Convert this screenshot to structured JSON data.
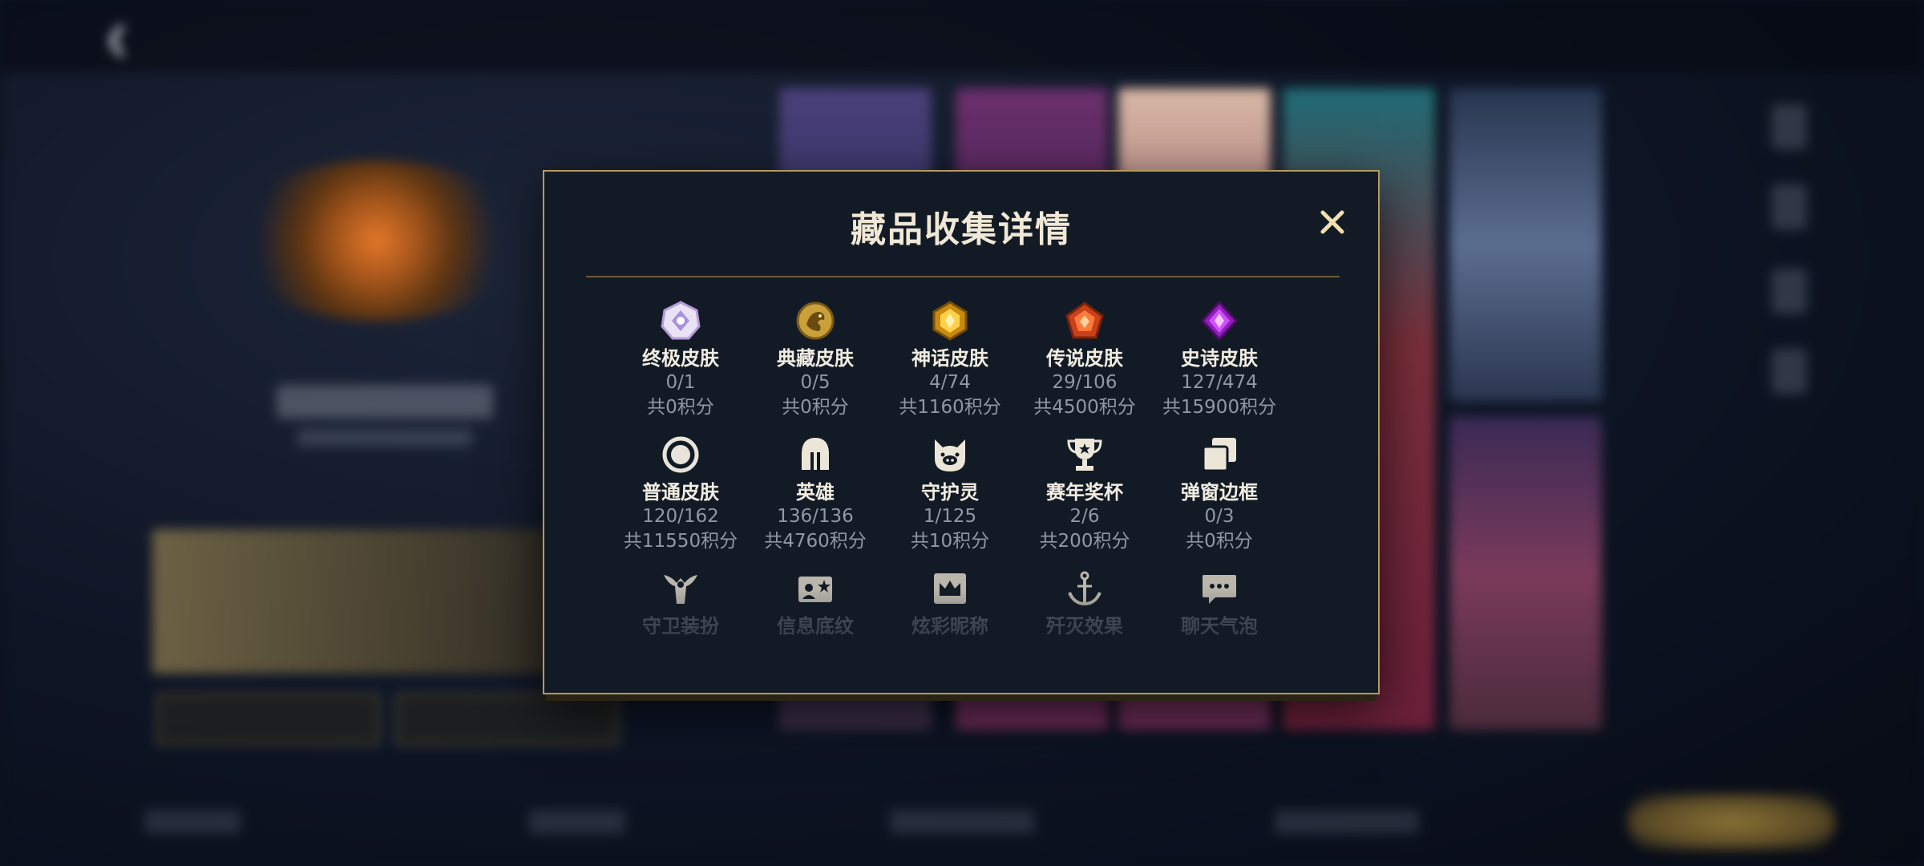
{
  "dialog": {
    "title": "藏品收集详情",
    "close_icon": "close-icon"
  },
  "collections": [
    {
      "name": "终极皮肤",
      "count": "0/1",
      "points": "共0积分",
      "icon": "ultimate-skin-icon"
    },
    {
      "name": "典藏皮肤",
      "count": "0/5",
      "points": "共0积分",
      "icon": "legendary-collection-skin-icon"
    },
    {
      "name": "神话皮肤",
      "count": "4/74",
      "points": "共1160积分",
      "icon": "mythic-skin-icon"
    },
    {
      "name": "传说皮肤",
      "count": "29/106",
      "points": "共4500积分",
      "icon": "legend-skin-icon"
    },
    {
      "name": "史诗皮肤",
      "count": "127/474",
      "points": "共15900积分",
      "icon": "epic-skin-icon"
    },
    {
      "name": "普通皮肤",
      "count": "120/162",
      "points": "共11550积分",
      "icon": "normal-skin-icon"
    },
    {
      "name": "英雄",
      "count": "136/136",
      "points": "共4760积分",
      "icon": "hero-helmet-icon"
    },
    {
      "name": "守护灵",
      "count": "1/125",
      "points": "共10积分",
      "icon": "guardian-spirit-icon"
    },
    {
      "name": "赛年奖杯",
      "count": "2/6",
      "points": "共200积分",
      "icon": "trophy-icon"
    },
    {
      "name": "弹窗边框",
      "count": "0/3",
      "points": "共0积分",
      "icon": "popup-frame-icon"
    },
    {
      "name": "守卫装扮",
      "icon": "guard-outfit-icon"
    },
    {
      "name": "信息底纹",
      "icon": "info-background-icon"
    },
    {
      "name": "炫彩昵称",
      "icon": "colorful-nickname-icon"
    },
    {
      "name": "歼灭效果",
      "icon": "annihilation-effect-icon"
    },
    {
      "name": "聊天气泡",
      "icon": "chat-bubble-icon"
    }
  ],
  "colors": {
    "dialog_border": "#b59a5d",
    "dialog_bg": "#121b25",
    "title": "#f0e8d6",
    "muted_text": "#8f98a5"
  }
}
